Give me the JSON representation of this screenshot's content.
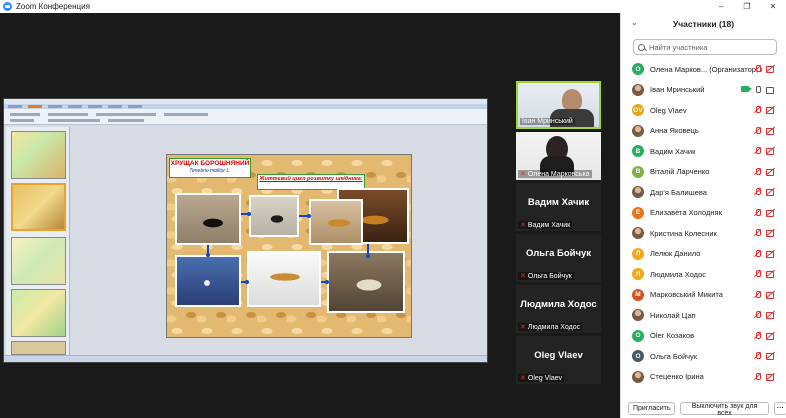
{
  "window": {
    "title": "Zoom Конференция",
    "controls": [
      "–",
      "❐",
      "✕"
    ]
  },
  "slide": {
    "title": "ХРУЩАК БОРОШНЯНИЙ",
    "subtitle": "Tenebrio molitor L.",
    "life_cycle": "Життєвий цикл розвитку шкідника:"
  },
  "videos": [
    {
      "name": "Іван Мринський",
      "camera": true,
      "muted": false
    },
    {
      "name": "Олена Марковська",
      "camera": true,
      "muted": true
    },
    {
      "name": "Вадим Хачик",
      "camera": false,
      "muted": true
    },
    {
      "name": "Ольга Бойчук",
      "camera": false,
      "muted": true
    },
    {
      "name": "Людмила Ходос",
      "camera": false,
      "muted": true
    },
    {
      "name": "Oleg Vlaev",
      "camera": false,
      "muted": true
    }
  ],
  "panel": {
    "title": "Участники (18)",
    "search_placeholder": "Найти участника",
    "invite": "Пригласить",
    "mute_all": "Выключить звук для всех",
    "more": "···"
  },
  "participants": [
    {
      "name": "Олена Марков... (Организатор, я)",
      "initial": "O",
      "color": "#27ae60",
      "mic": "off",
      "cam": "off"
    },
    {
      "name": "Іван Мринський",
      "initial": "",
      "color": "#8a7060",
      "photo": true,
      "mic": "on",
      "cam": "on"
    },
    {
      "name": "Oleg Vlaev",
      "initial": "OV",
      "color": "#e8a317",
      "mic": "off",
      "cam": "off"
    },
    {
      "name": "Анна Яковець",
      "initial": "",
      "color": "#a07858",
      "photo": true,
      "mic": "off",
      "cam": "off"
    },
    {
      "name": "Вадим Хачик",
      "initial": "В",
      "color": "#27ae60",
      "mic": "off",
      "cam": "off"
    },
    {
      "name": "Віталій Ларченко",
      "initial": "В",
      "color": "#7cb342",
      "mic": "off",
      "cam": "off"
    },
    {
      "name": "Дар'я Балишева",
      "initial": "",
      "color": "#b08868",
      "photo": true,
      "mic": "off",
      "cam": "off"
    },
    {
      "name": "Елизавета Холодняк",
      "initial": "Е",
      "color": "#e8731a",
      "mic": "off",
      "cam": "off"
    },
    {
      "name": "Кристина Колесник",
      "initial": "",
      "color": "#c0a080",
      "photo": true,
      "mic": "off",
      "cam": "off"
    },
    {
      "name": "Лелюк Данило",
      "initial": "Л",
      "color": "#f2a618",
      "mic": "off",
      "cam": "off"
    },
    {
      "name": "Людмила Ходос",
      "initial": "Л",
      "color": "#f2a618",
      "mic": "off",
      "cam": "off"
    },
    {
      "name": "Марковський Микита",
      "initial": "М",
      "color": "#d35420",
      "mic": "off",
      "cam": "off"
    },
    {
      "name": "Николай Цап",
      "initial": "",
      "color": "#7a6a5a",
      "photo": true,
      "mic": "off",
      "cam": "off"
    },
    {
      "name": "Olег Козаков",
      "initial": "O",
      "color": "#27ae60",
      "mic": "off",
      "cam": "off"
    },
    {
      "name": "Ольга Бойчук",
      "initial": "O",
      "color": "#455a64",
      "mic": "off",
      "cam": "off"
    },
    {
      "name": "Стеценко Ірина",
      "initial": "",
      "color": "#a88868",
      "photo": true,
      "mic": "off",
      "cam": "off"
    }
  ]
}
